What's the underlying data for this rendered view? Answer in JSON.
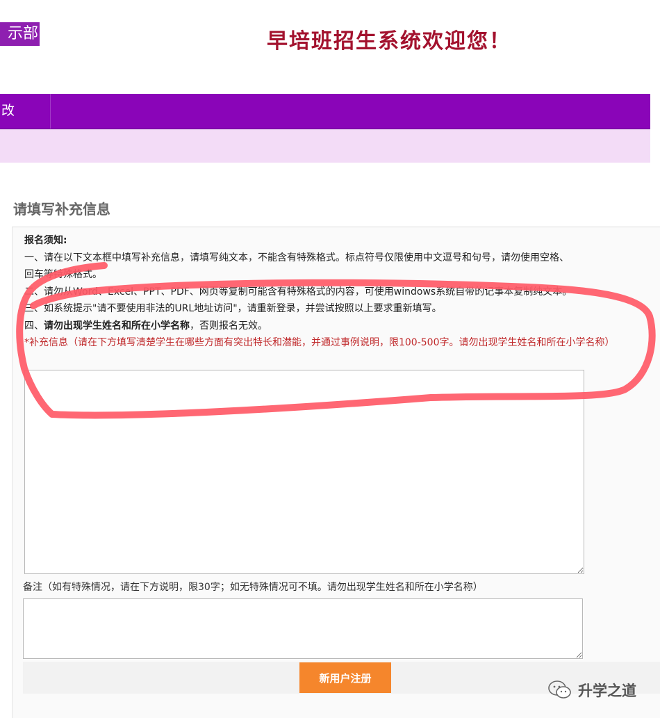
{
  "header": {
    "badge": "示部",
    "title": "早培班招生系统欢迎您！"
  },
  "nav": {
    "items": [
      {
        "label": "改"
      }
    ]
  },
  "form": {
    "section_title": "请填写补充信息",
    "notice": {
      "heading": "报名须知:",
      "line1": "一、请在以下文本框中填写补充信息，请填写纯文本，不能含有特殊格式。标点符号仅限使用中文逗号和句号，请勿使用空格、",
      "line2": "回车等特殊格式。",
      "line3": "二、请勿从Word、Excel、PPT、PDF、网页等复制可能含有特殊格式的内容，可使用windows系统自带的记事本复制纯文本。",
      "line4": "三、如系统提示\"请不要使用非法的URL地址访问\"，请重新登录，并尝试按照以上要求重新填写。",
      "line5_prefix": "四、",
      "line5_bold": "请勿出现学生姓名和所在小学名称",
      "line5_suffix": "，否则报名无效。"
    },
    "supplement_label": "*补充信息（请在下方填写清楚学生在哪些方面有突出特长和潜能，并通过事例说明，限100-500字。请勿出现学生姓名和所在小学名称）",
    "supplement_value": "",
    "remark_label": "备注（如有特殊情况，请在下方说明，限30字；如无特殊情况可不填。请勿出现学生姓名和所在小学名称）",
    "remark_value": "",
    "register_button": "新用户注册"
  },
  "watermark": {
    "text": "升学之道",
    "icon": "wechat-icon"
  },
  "colors": {
    "nav_purple": "#8a05b8",
    "subbar_lilac": "#f3dcf7",
    "title_red": "#a3122e",
    "required_red": "#c0292b",
    "button_orange": "#f5862c",
    "annotation_red": "#ff5a67"
  }
}
